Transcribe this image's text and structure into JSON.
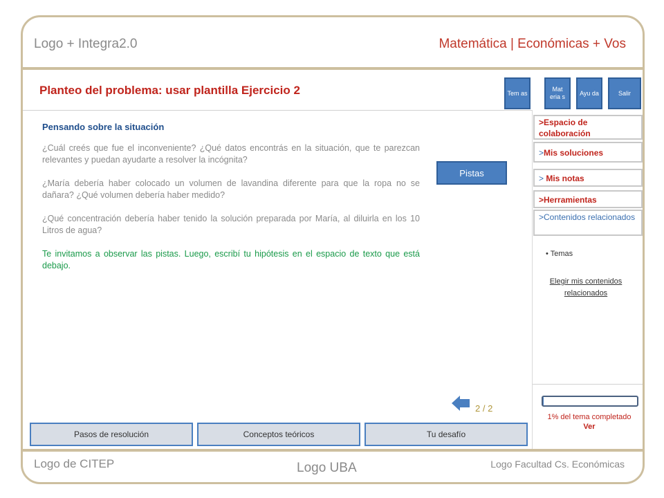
{
  "header": {
    "brand": "Logo + Integra2.0",
    "course": "Matemática | Económicas + Vos"
  },
  "problem": {
    "title": "Planteo del problema: usar plantilla Ejercicio 2"
  },
  "nav_buttons": [
    {
      "label": "Tem as"
    },
    {
      "label": "Mat eria s"
    },
    {
      "label": "Ayu da"
    },
    {
      "label": "Salir"
    }
  ],
  "content": {
    "heading": "Pensando  sobre  la situación",
    "paragraphs": [
      "¿Cuál creés que fue el inconveniente? ¿Qué datos encontrás en la situación, que te parezcan relevantes y puedan ayudarte a resolver la incógnita?",
      "¿María debería haber colocado un volumen de lavandina diferente para que la ropa no se dañara? ¿Qué volumen debería haber medido?",
      "¿Qué concentración debería haber tenido la solución preparada por María, al diluirla en los 10 Litros de agua?"
    ],
    "invite": "Te invitamos a observar las pistas. Luego, escribí tu hipótesis en el espacio de texto que está debajo."
  },
  "pistas_label": "Pistas",
  "side_panel": {
    "items": [
      {
        "label": ">Espacio de colaboración"
      },
      {
        "chevron": ">",
        "label": "Mis soluciones"
      },
      {
        "chevron": "> ",
        "label": "Mis notas"
      },
      {
        "label": ">Herramientas"
      },
      {
        "label": ">Contenidos relacionados"
      }
    ],
    "temas_bullet": "• Temas",
    "elegir_link": "Elegir mis contenidos relacionados"
  },
  "progress": {
    "percent": 1,
    "text": "1% del tema completado",
    "ver_label": "Ver"
  },
  "pagination": {
    "text": "2 / 2"
  },
  "bottom_tabs": [
    {
      "label": "Pasos de resolución"
    },
    {
      "label": "Conceptos teóricos"
    },
    {
      "label": "Tu desafío"
    }
  ],
  "footer": {
    "left": "Logo de CITEP",
    "middle": "Logo UBA",
    "right": "Logo Facultad Cs. Económicas"
  },
  "icons": {
    "back": "arrow-left-icon"
  },
  "colors": {
    "accent_blue": "#4a7fc0",
    "title_red": "#c0241c",
    "frame_tan": "#cdbf9f",
    "invite_green": "#1a9a4a"
  }
}
